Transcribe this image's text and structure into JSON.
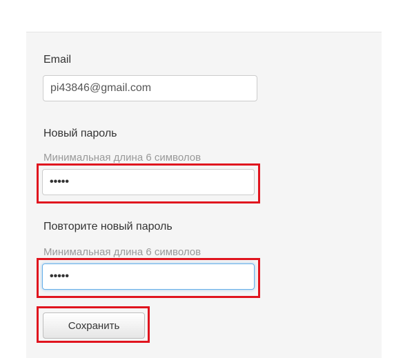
{
  "form": {
    "email": {
      "label": "Email",
      "value": "pi43846@gmail.com"
    },
    "new_password": {
      "label": "Новый пароль",
      "hint": "Минимальная длина 6 символов",
      "masked_value": "•••••"
    },
    "repeat_password": {
      "label": "Повторите новый пароль",
      "hint": "Минимальная длина 6 символов",
      "masked_value": "•••••"
    },
    "save_label": "Сохранить"
  },
  "colors": {
    "panel_background": "#f5f5f5",
    "highlight": "#e0141e",
    "focus_border": "#66afe9"
  }
}
